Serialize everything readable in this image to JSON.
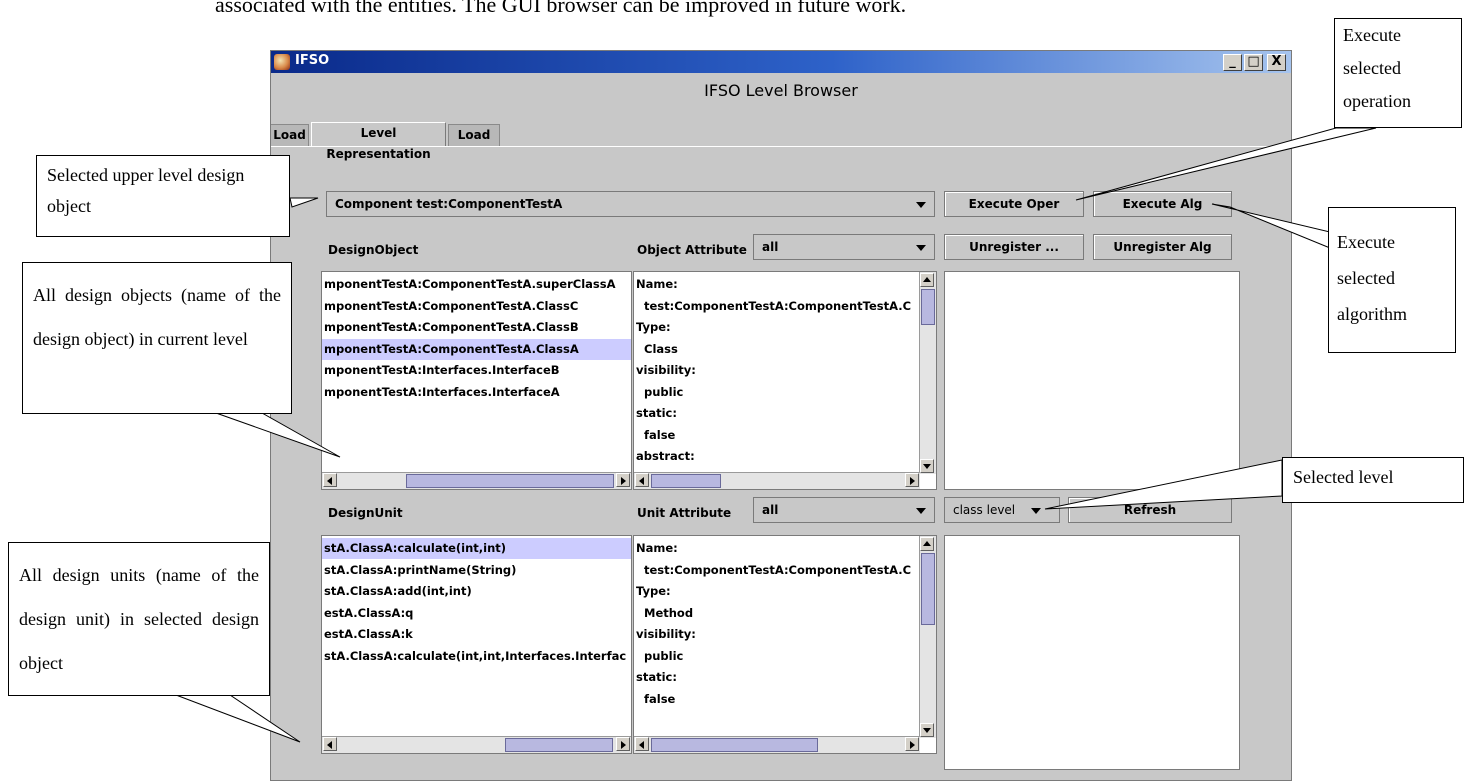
{
  "document": {
    "caption": "associated with the entities. The GUI browser can be improved in future work."
  },
  "window": {
    "title": "IFSO",
    "controls": {
      "minimize": "_",
      "maximize": "□",
      "close": "X"
    },
    "heading": "IFSO Level Browser",
    "tabs": [
      {
        "label": "Load",
        "active": false
      },
      {
        "label": "Level Representation",
        "active": true
      },
      {
        "label": "Load",
        "active": false
      }
    ],
    "top_combo": {
      "value": "Component test:ComponentTestA"
    },
    "buttons": {
      "execute_oper": "Execute Oper",
      "execute_alg": "Execute Alg",
      "unregister_oper": "Unregister ...",
      "unregister_alg": "Unregister Alg",
      "refresh": "Refresh"
    },
    "design_object": {
      "label": "DesignObject",
      "attr_label": "Object Attribute",
      "attr_filter": "all",
      "items": [
        "mponentTestA:ComponentTestA.superClassA",
        "mponentTestA:ComponentTestA.ClassC",
        "mponentTestA:ComponentTestA.ClassB",
        "mponentTestA:ComponentTestA.ClassA",
        "mponentTestA:Interfaces.InterfaceB",
        "mponentTestA:Interfaces.InterfaceA"
      ],
      "selected_index": 3,
      "attributes": [
        "Name:",
        "  test:ComponentTestA:ComponentTestA.C",
        "Type:",
        "  Class",
        "visibility:",
        "  public",
        "static:",
        "  false",
        "abstract:"
      ]
    },
    "design_unit": {
      "label": "DesignUnit",
      "attr_label": "Unit Attribute",
      "attr_filter": "all",
      "level": "class level",
      "items": [
        "stA.ClassA:calculate(int,int)",
        "stA.ClassA:printName(String)",
        "stA.ClassA:add(int,int)",
        "estA.ClassA:q",
        "estA.ClassA:k",
        "stA.ClassA:calculate(int,int,Interfaces.Interfac"
      ],
      "selected_index": 0,
      "attributes": [
        "Name:",
        "  test:ComponentTestA:ComponentTestA.C",
        "Type:",
        "  Method",
        "visibility:",
        "  public",
        "static:",
        "  false"
      ]
    }
  },
  "callouts": {
    "execute_oper": "Execute selected operation",
    "upper_level": "Selected upper level design object",
    "execute_alg": "Execute selected algorithm",
    "all_objects": "All design objects (name of the design object) in current level",
    "selected_level": "Selected level",
    "all_units": "All design units (name of the design unit) in selected design object"
  }
}
